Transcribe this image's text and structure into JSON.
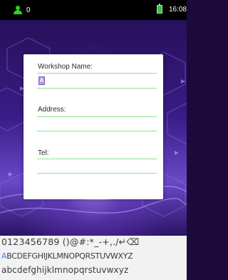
{
  "status_bar": {
    "user_count": "0",
    "time": "16:08"
  },
  "form": {
    "workshop_name_label": "Workshop Name:",
    "workshop_name_cursor": "A",
    "address_label": "Address:",
    "tel_label": "Tel:"
  },
  "keyboard": {
    "row1": "0123456789 ()@#:*_-+,./↵⌫",
    "row2_first": "A",
    "row2_rest": "BCDEFGHIJKLMNOPQRSTUVWXYZ",
    "row3": "abcdefghijklmnopqrstuvwxyz"
  },
  "colors": {
    "status_icon": "#2fd21f",
    "form_lines": "#8be38b",
    "background": "#3a1c86",
    "keyboard_highlight": "#4a7bff"
  }
}
